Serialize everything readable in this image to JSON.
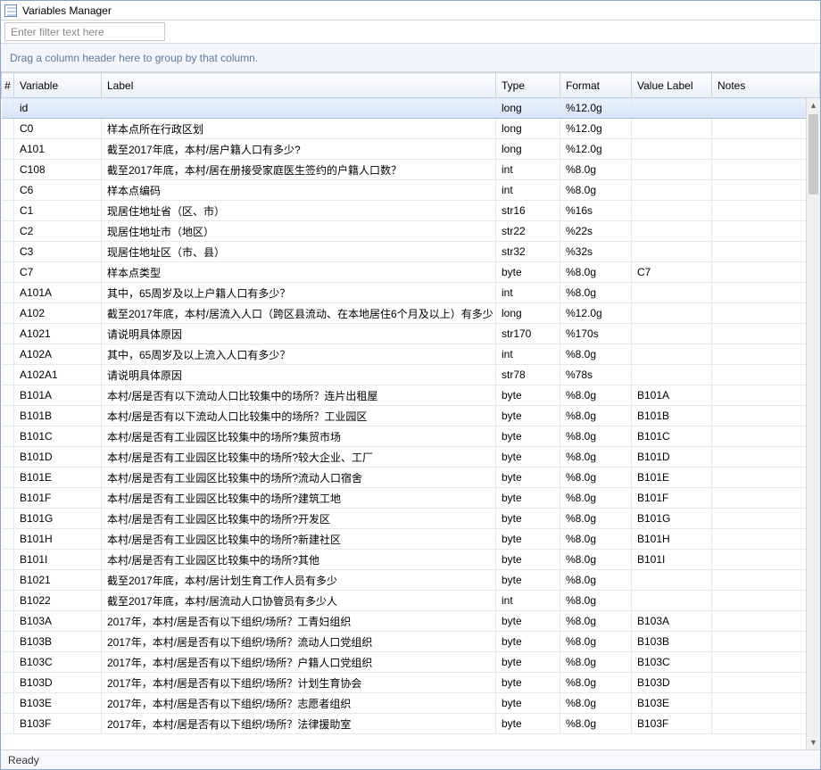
{
  "window": {
    "title": "Variables Manager"
  },
  "filter": {
    "placeholder": "Enter filter text here"
  },
  "groupzone": {
    "text": "Drag a column header here to group by that column."
  },
  "columns": {
    "idx": "#",
    "variable": "Variable",
    "label": "Label",
    "type": "Type",
    "format": "Format",
    "value_label": "Value Label",
    "notes": "Notes"
  },
  "status": {
    "text": "Ready"
  },
  "rows": [
    {
      "variable": "id",
      "label": "",
      "type": "long",
      "format": "%12.0g",
      "value_label": "",
      "notes": ""
    },
    {
      "variable": "C0",
      "label": "样本点所在行政区划",
      "type": "long",
      "format": "%12.0g",
      "value_label": "",
      "notes": ""
    },
    {
      "variable": "A101",
      "label": "截至2017年底，本村/居户籍人口有多少?",
      "type": "long",
      "format": "%12.0g",
      "value_label": "",
      "notes": ""
    },
    {
      "variable": "C108",
      "label": "截至2017年底，本村/居在册接受家庭医生签约的户籍人口数？",
      "type": "int",
      "format": "%8.0g",
      "value_label": "",
      "notes": ""
    },
    {
      "variable": "C6",
      "label": "样本点编码",
      "type": "int",
      "format": "%8.0g",
      "value_label": "",
      "notes": ""
    },
    {
      "variable": "C1",
      "label": "现居住地址省（区、市）",
      "type": "str16",
      "format": "%16s",
      "value_label": "",
      "notes": ""
    },
    {
      "variable": "C2",
      "label": "现居住地址市（地区）",
      "type": "str22",
      "format": "%22s",
      "value_label": "",
      "notes": ""
    },
    {
      "variable": "C3",
      "label": "现居住地址区（市、县）",
      "type": "str32",
      "format": "%32s",
      "value_label": "",
      "notes": ""
    },
    {
      "variable": "C7",
      "label": "样本点类型",
      "type": "byte",
      "format": "%8.0g",
      "value_label": "C7",
      "notes": ""
    },
    {
      "variable": "A101A",
      "label": "其中，65周岁及以上户籍人口有多少？",
      "type": "int",
      "format": "%8.0g",
      "value_label": "",
      "notes": ""
    },
    {
      "variable": "A102",
      "label": "截至2017年底，本村/居流入人口（跨区县流动、在本地居住6个月及以上）有多少",
      "type": "long",
      "format": "%12.0g",
      "value_label": "",
      "notes": ""
    },
    {
      "variable": "A1021",
      "label": "请说明具体原因",
      "type": "str170",
      "format": "%170s",
      "value_label": "",
      "notes": ""
    },
    {
      "variable": "A102A",
      "label": "其中，65周岁及以上流入人口有多少？",
      "type": "int",
      "format": "%8.0g",
      "value_label": "",
      "notes": ""
    },
    {
      "variable": "A102A1",
      "label": "请说明具体原因",
      "type": "str78",
      "format": "%78s",
      "value_label": "",
      "notes": ""
    },
    {
      "variable": "B101A",
      "label": "本村/居是否有以下流动人口比较集中的场所？连片出租屋",
      "type": "byte",
      "format": "%8.0g",
      "value_label": "B101A",
      "notes": ""
    },
    {
      "variable": "B101B",
      "label": "本村/居是否有以下流动人口比较集中的场所？工业园区",
      "type": "byte",
      "format": "%8.0g",
      "value_label": "B101B",
      "notes": ""
    },
    {
      "variable": "B101C",
      "label": "本村/居是否有工业园区比较集中的场所?集贸市场",
      "type": "byte",
      "format": "%8.0g",
      "value_label": "B101C",
      "notes": ""
    },
    {
      "variable": "B101D",
      "label": "本村/居是否有工业园区比较集中的场所?较大企业、工厂",
      "type": "byte",
      "format": "%8.0g",
      "value_label": "B101D",
      "notes": ""
    },
    {
      "variable": "B101E",
      "label": "本村/居是否有工业园区比较集中的场所?流动人口宿舍",
      "type": "byte",
      "format": "%8.0g",
      "value_label": "B101E",
      "notes": ""
    },
    {
      "variable": "B101F",
      "label": "本村/居是否有工业园区比较集中的场所?建筑工地",
      "type": "byte",
      "format": "%8.0g",
      "value_label": "B101F",
      "notes": ""
    },
    {
      "variable": "B101G",
      "label": "本村/居是否有工业园区比较集中的场所?开发区",
      "type": "byte",
      "format": "%8.0g",
      "value_label": "B101G",
      "notes": ""
    },
    {
      "variable": "B101H",
      "label": "本村/居是否有工业园区比较集中的场所?新建社区",
      "type": "byte",
      "format": "%8.0g",
      "value_label": "B101H",
      "notes": ""
    },
    {
      "variable": "B101I",
      "label": "本村/居是否有工业园区比较集中的场所?其他",
      "type": "byte",
      "format": "%8.0g",
      "value_label": "B101I",
      "notes": ""
    },
    {
      "variable": "B1021",
      "label": "截至2017年底，本村/居计划生育工作人员有多少",
      "type": "byte",
      "format": "%8.0g",
      "value_label": "",
      "notes": ""
    },
    {
      "variable": "B1022",
      "label": "截至2017年底，本村/居流动人口协管员有多少人",
      "type": "int",
      "format": "%8.0g",
      "value_label": "",
      "notes": ""
    },
    {
      "variable": "B103A",
      "label": "2017年，本村/居是否有以下组织/场所？工青妇组织",
      "type": "byte",
      "format": "%8.0g",
      "value_label": "B103A",
      "notes": ""
    },
    {
      "variable": "B103B",
      "label": "2017年，本村/居是否有以下组织/场所？流动人口党组织",
      "type": "byte",
      "format": "%8.0g",
      "value_label": "B103B",
      "notes": ""
    },
    {
      "variable": "B103C",
      "label": "2017年，本村/居是否有以下组织/场所？户籍人口党组织",
      "type": "byte",
      "format": "%8.0g",
      "value_label": "B103C",
      "notes": ""
    },
    {
      "variable": "B103D",
      "label": "2017年，本村/居是否有以下组织/场所？计划生育协会",
      "type": "byte",
      "format": "%8.0g",
      "value_label": "B103D",
      "notes": ""
    },
    {
      "variable": "B103E",
      "label": "2017年，本村/居是否有以下组织/场所？志愿者组织",
      "type": "byte",
      "format": "%8.0g",
      "value_label": "B103E",
      "notes": ""
    },
    {
      "variable": "B103F",
      "label": "2017年，本村/居是否有以下组织/场所？法律援助室",
      "type": "byte",
      "format": "%8.0g",
      "value_label": "B103F",
      "notes": ""
    }
  ]
}
